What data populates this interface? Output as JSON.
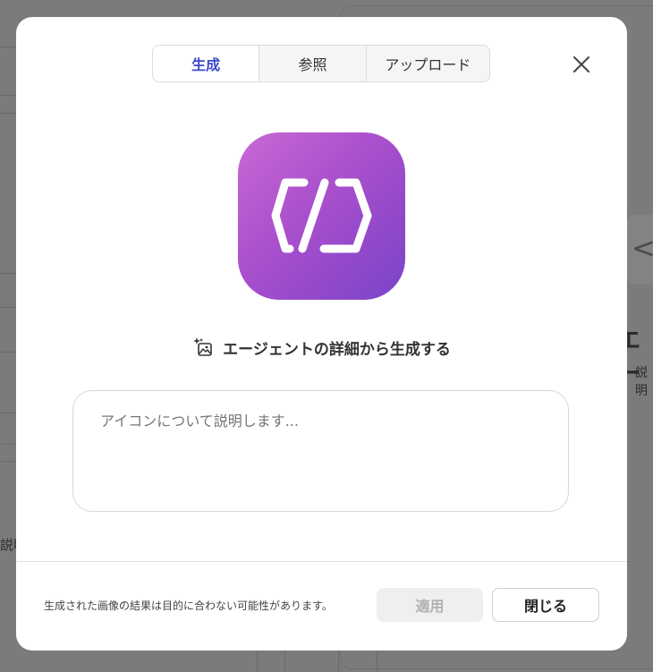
{
  "background": {
    "right_title": "エー",
    "right_sub": "説明",
    "left_text": "説明"
  },
  "tabs": [
    {
      "label": "生成",
      "active": true
    },
    {
      "label": "参照",
      "active": false
    },
    {
      "label": "アップロード",
      "active": false
    }
  ],
  "icons": {
    "close": "close-icon",
    "app": "code-brackets-icon",
    "generate": "sparkle-image-icon"
  },
  "generate_from_details": "エージェントの詳細から生成する",
  "description_input": {
    "placeholder": "アイコンについて説明します...",
    "value": ""
  },
  "footer": {
    "note": "生成された画像の結果は目的に合わない可能性があります。",
    "apply_label": "適用",
    "close_label": "閉じる"
  },
  "colors": {
    "accent": "#3b49c8",
    "icon_gradient_start": "#c969d6",
    "icon_gradient_end": "#7a43c9"
  }
}
